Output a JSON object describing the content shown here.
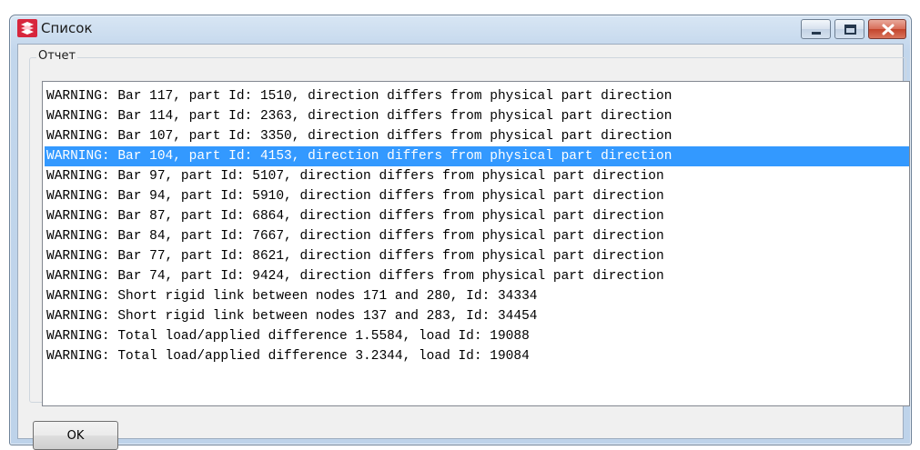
{
  "window": {
    "title": "Список",
    "controls": [
      "minimize-icon",
      "maximize-icon",
      "close-icon"
    ]
  },
  "report": {
    "group_label": "Отчет",
    "selected_index": 3,
    "items": [
      "WARNING: Bar 117, part Id: 1510, direction differs from physical part direction",
      "WARNING: Bar 114, part Id: 2363, direction differs from physical part direction",
      "WARNING: Bar 107, part Id: 3350, direction differs from physical part direction",
      "WARNING: Bar 104, part Id: 4153, direction differs from physical part direction",
      "WARNING: Bar 97, part Id: 5107, direction differs from physical part direction",
      "WARNING: Bar 94, part Id: 5910, direction differs from physical part direction",
      "WARNING: Bar 87, part Id: 6864, direction differs from physical part direction",
      "WARNING: Bar 84, part Id: 7667, direction differs from physical part direction",
      "WARNING: Bar 77, part Id: 8621, direction differs from physical part direction",
      "WARNING: Bar 74, part Id: 9424, direction differs from physical part direction",
      "WARNING: Short rigid link between nodes 171 and 280, Id: 34334",
      "WARNING: Short rigid link between nodes 137 and 283, Id: 34454",
      "WARNING: Total load/applied difference 1.5584, load Id: 19088",
      "WARNING: Total load/applied difference 3.2344, load Id: 19084"
    ]
  },
  "buttons": {
    "ok_label": "OK"
  },
  "colors": {
    "selection": "#3399ff",
    "close_button": "#c3442b"
  }
}
